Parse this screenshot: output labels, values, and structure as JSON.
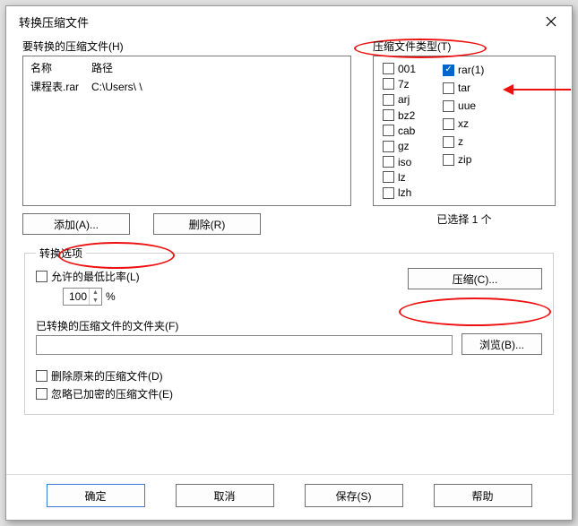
{
  "window": {
    "title": "转换压缩文件"
  },
  "filesSection": {
    "label": "要转换的压缩文件(H)",
    "headers": {
      "name": "名称",
      "path": "路径"
    },
    "rows": [
      {
        "name": "课程表.rar",
        "path": "C:\\Users\\                         \\"
      }
    ],
    "addBtn": "添加(A)...",
    "deleteBtn": "删除(R)"
  },
  "typesSection": {
    "label": "压缩文件类型(T)",
    "colA": [
      {
        "label": "001",
        "checked": false
      },
      {
        "label": "7z",
        "checked": false
      },
      {
        "label": "arj",
        "checked": false
      },
      {
        "label": "bz2",
        "checked": false
      },
      {
        "label": "cab",
        "checked": false
      },
      {
        "label": "gz",
        "checked": false
      },
      {
        "label": "iso",
        "checked": false
      },
      {
        "label": "lz",
        "checked": false
      },
      {
        "label": "lzh",
        "checked": false
      }
    ],
    "colB": [
      {
        "label": "rar(1)",
        "checked": true
      },
      {
        "label": "tar",
        "checked": false
      },
      {
        "label": "uue",
        "checked": false
      },
      {
        "label": "xz",
        "checked": false
      },
      {
        "label": "z",
        "checked": false
      },
      {
        "label": "zip",
        "checked": false
      }
    ],
    "selectedText": "已选择 1 个"
  },
  "options": {
    "legend": "转换选项",
    "minRatio": {
      "label": "允许的最低比率(L)",
      "checked": false,
      "value": "100",
      "suffix": "%"
    },
    "compressBtn": "压缩(C)...",
    "folderLabel": "已转换的压缩文件的文件夹(F)",
    "folderValue": "",
    "browseBtn": "浏览(B)...",
    "deleteOriginal": {
      "label": "删除原来的压缩文件(D)",
      "checked": false
    },
    "ignoreEncrypted": {
      "label": "忽略已加密的压缩文件(E)",
      "checked": false
    }
  },
  "footer": {
    "ok": "确定",
    "cancel": "取消",
    "save": "保存(S)",
    "help": "帮助"
  }
}
